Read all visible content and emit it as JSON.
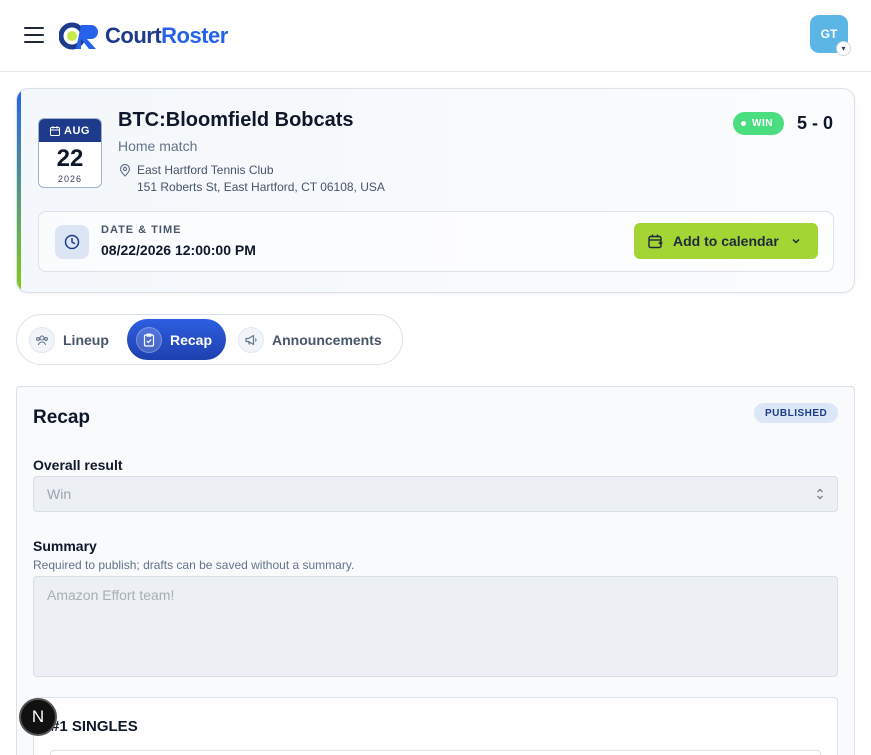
{
  "header": {
    "logo_part1": "Court",
    "logo_part2": "Roster",
    "avatar_initials": "GT"
  },
  "match": {
    "month": "AUG",
    "day": "22",
    "year": "2026",
    "title": "BTC:Bloomfield Bobcats",
    "subtitle": "Home match",
    "location_name": "East Hartford Tennis Club",
    "location_address": "151 Roberts St, East Hartford, CT 06108, USA",
    "result_badge": "WIN",
    "score": "5 - 0",
    "datetime_label": "DATE & TIME",
    "datetime_value": "08/22/2026 12:00:00 PM",
    "calendar_button": "Add to calendar"
  },
  "tabs": [
    {
      "label": "Lineup",
      "icon": "users-icon"
    },
    {
      "label": "Recap",
      "icon": "clipboard-check-icon",
      "active": true
    },
    {
      "label": "Announcements",
      "icon": "megaphone-icon"
    }
  ],
  "recap": {
    "title": "Recap",
    "status_badge": "PUBLISHED",
    "overall_result_label": "Overall result",
    "overall_result_value": "Win",
    "summary_label": "Summary",
    "summary_help": "Required to publish; drafts can be saved without a summary.",
    "summary_value": "Amazon Effort team!",
    "singles_heading": "#1 SINGLES"
  },
  "colors": {
    "brand_dark": "#1e3a8a",
    "brand_blue": "#2563eb",
    "accent_green": "#a3d634",
    "win_green": "#4ade80"
  },
  "dev_badge": "N"
}
